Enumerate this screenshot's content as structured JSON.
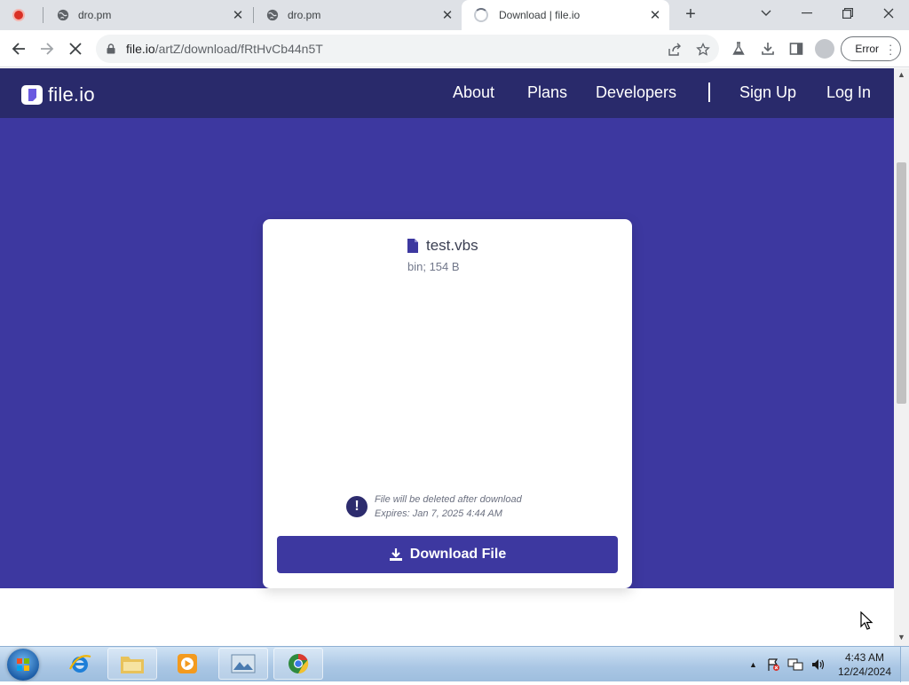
{
  "browser": {
    "tabs": [
      {
        "title": "",
        "favicon": "recording-dot-icon"
      },
      {
        "title": "dro.pm",
        "favicon": "globe-icon"
      },
      {
        "title": "dro.pm",
        "favicon": "globe-icon"
      },
      {
        "title": "Download | file.io",
        "favicon": "loading-spinner-icon",
        "active": true
      }
    ],
    "url_host": "file.io",
    "url_path": "/artZ/download/fRtHvCb44n5T",
    "profile_status": "Error"
  },
  "site": {
    "logo_text": "file.io",
    "nav": {
      "about": "About",
      "plans": "Plans",
      "developers": "Developers",
      "sign_up": "Sign Up",
      "log_in": "Log In"
    },
    "colors": {
      "header": "#292a6b",
      "hero": "#3d38a0",
      "button": "#3d38a0"
    }
  },
  "file": {
    "name": "test.vbs",
    "meta": "bin; 154 B",
    "notice_line1": "File will be deleted after download",
    "notice_line2": "Expires: Jan 7, 2025 4:44 AM",
    "download_label": "Download File"
  },
  "taskbar": {
    "time": "4:43 AM",
    "date": "12/24/2024"
  }
}
